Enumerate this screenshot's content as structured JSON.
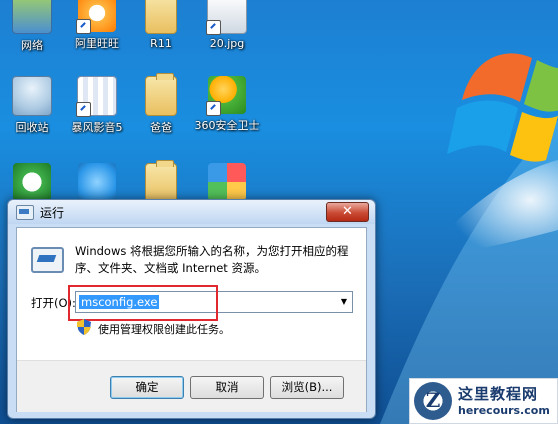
{
  "desktop": {
    "icons": [
      {
        "label": "网络",
        "type": "network"
      },
      {
        "label": "阿里旺旺",
        "type": "aliwangwang"
      },
      {
        "label": "R11",
        "type": "folder"
      },
      {
        "label": "20.jpg",
        "type": "image"
      },
      {
        "label": "回收站",
        "type": "recycle-bin"
      },
      {
        "label": "暴风影音5",
        "type": "video-player"
      },
      {
        "label": "爸爸",
        "type": "folder"
      },
      {
        "label": "360安全卫士",
        "type": "security"
      }
    ]
  },
  "run_dialog": {
    "title": "运行",
    "close_label": "✕",
    "description": "Windows 将根据您所输入的名称，为您打开相应的程序、文件夹、文档或 Internet 资源。",
    "open_label": "打开(O):",
    "open_value": "msconfig.exe",
    "admin_note": "使用管理权限创建此任务。",
    "buttons": {
      "ok": "确定",
      "cancel": "取消",
      "browse": "浏览(B)..."
    }
  },
  "watermark": {
    "logo_letter": "Z",
    "name": "这里教程网",
    "url": "herecours.com"
  }
}
